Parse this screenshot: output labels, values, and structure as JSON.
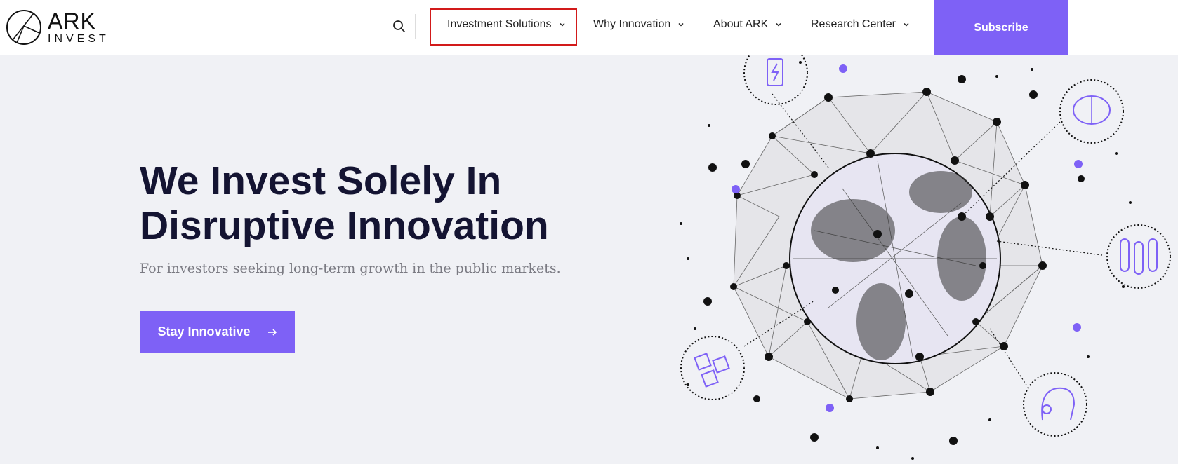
{
  "brand": {
    "line1": "ARK",
    "line2": "INVEST"
  },
  "nav": {
    "items": [
      {
        "label": "Investment Solutions",
        "icon": "chevron-down-icon"
      },
      {
        "label": "Why Innovation",
        "icon": "chevron-down-icon"
      },
      {
        "label": "About ARK",
        "icon": "chevron-down-icon"
      },
      {
        "label": "Research Center",
        "icon": "chevron-down-icon"
      }
    ],
    "subscribe_label": "Subscribe",
    "search_icon": "search-icon"
  },
  "hero": {
    "title_line1": "We Invest Solely In",
    "title_line2": "Disruptive Innovation",
    "subtitle": "For investors seeking long-term growth in the public markets.",
    "cta_label": "Stay Innovative",
    "cta_icon": "arrow-right-icon"
  },
  "colors": {
    "accent": "#7e61f6",
    "dark": "#141432",
    "background": "#f0f1f5",
    "highlight": "#d21a1a"
  }
}
